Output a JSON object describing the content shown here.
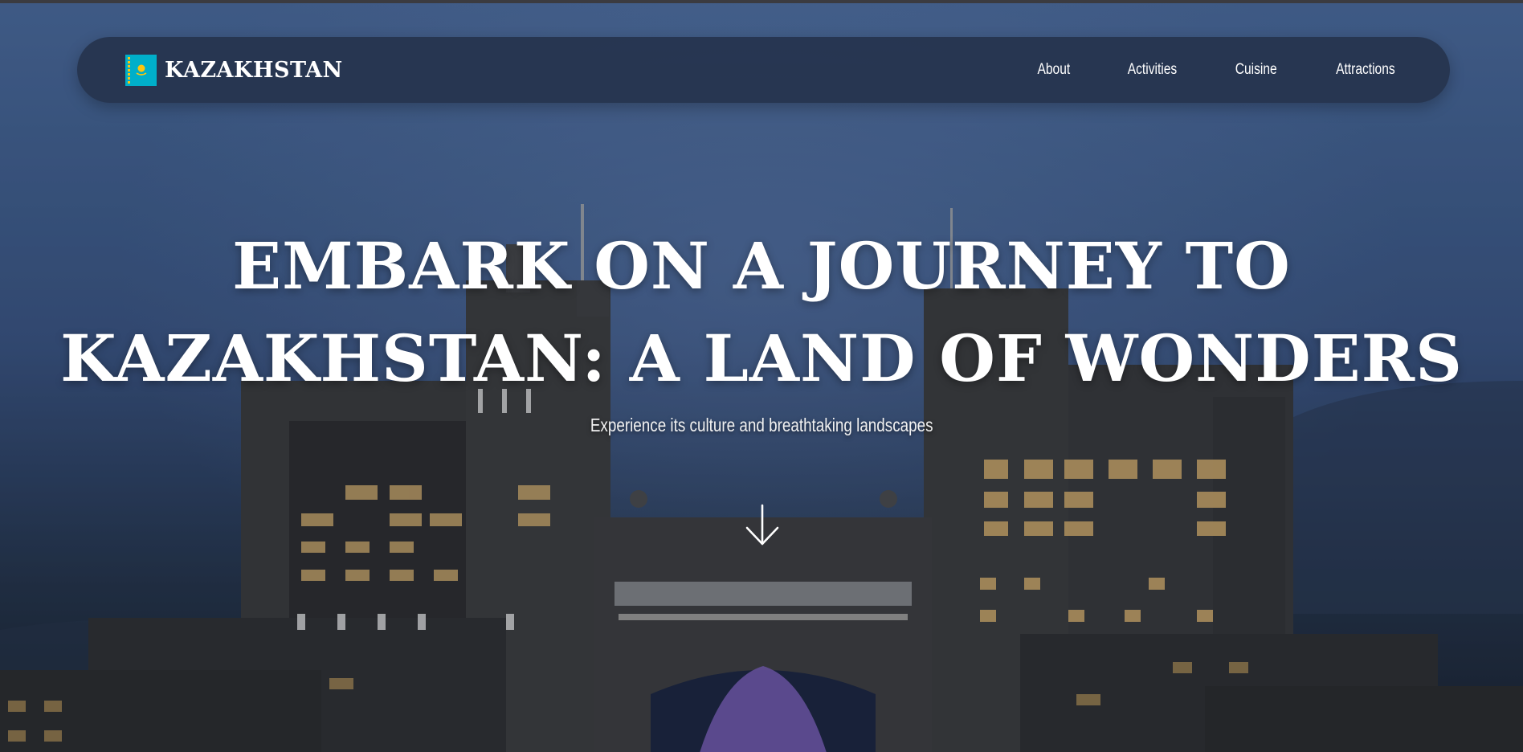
{
  "navbar": {
    "brand": {
      "name": "KAZAKHSTAN",
      "flag_icon": "kazakhstan-flag-icon"
    },
    "links": [
      {
        "label": "About"
      },
      {
        "label": "Activities"
      },
      {
        "label": "Cuisine"
      },
      {
        "label": "Attractions"
      }
    ]
  },
  "hero": {
    "title_line1": "EMBARK ON A JOURNEY TO",
    "title_line2": "KAZAKHSTAN: A LAND OF WONDERS",
    "subtitle": "Experience its culture and breathtaking landscapes",
    "scroll_icon": "arrow-down-icon"
  },
  "colors": {
    "navbar_bg": "#26344e",
    "flag_blue": "#00afca",
    "flag_gold": "#fec50c",
    "text": "#ffffff"
  }
}
